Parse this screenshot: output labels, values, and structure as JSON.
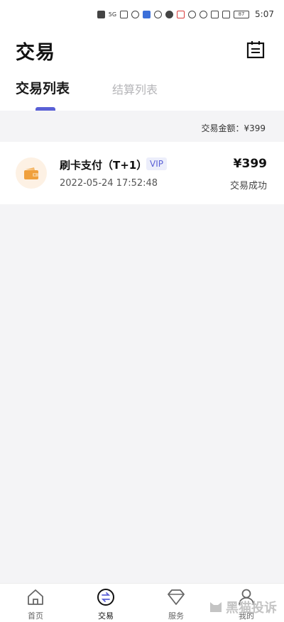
{
  "status_bar": {
    "time": "5:07",
    "network": "5G",
    "battery": "87"
  },
  "header": {
    "title": "交易"
  },
  "tabs": [
    {
      "label": "交易列表",
      "active": true
    },
    {
      "label": "结算列表",
      "active": false
    }
  ],
  "summary": {
    "text": "交易金额：¥399"
  },
  "transactions": [
    {
      "name": "刷卡支付（T+1）",
      "badge": "VIP",
      "time": "2022-05-24 17:52:48",
      "amount": "¥399",
      "status": "交易成功",
      "icon": "wallet-icon"
    }
  ],
  "bottom_nav": [
    {
      "label": "首页",
      "icon": "home-icon",
      "active": false
    },
    {
      "label": "交易",
      "icon": "exchange-icon",
      "active": true
    },
    {
      "label": "服务",
      "icon": "diamond-icon",
      "active": false
    },
    {
      "label": "我的",
      "icon": "user-icon",
      "active": false
    }
  ],
  "watermark": {
    "text": "黑猫投诉"
  },
  "colors": {
    "accent": "#5a60d6",
    "icon_orange": "#f0a03c",
    "background": "#f4f4f6"
  }
}
